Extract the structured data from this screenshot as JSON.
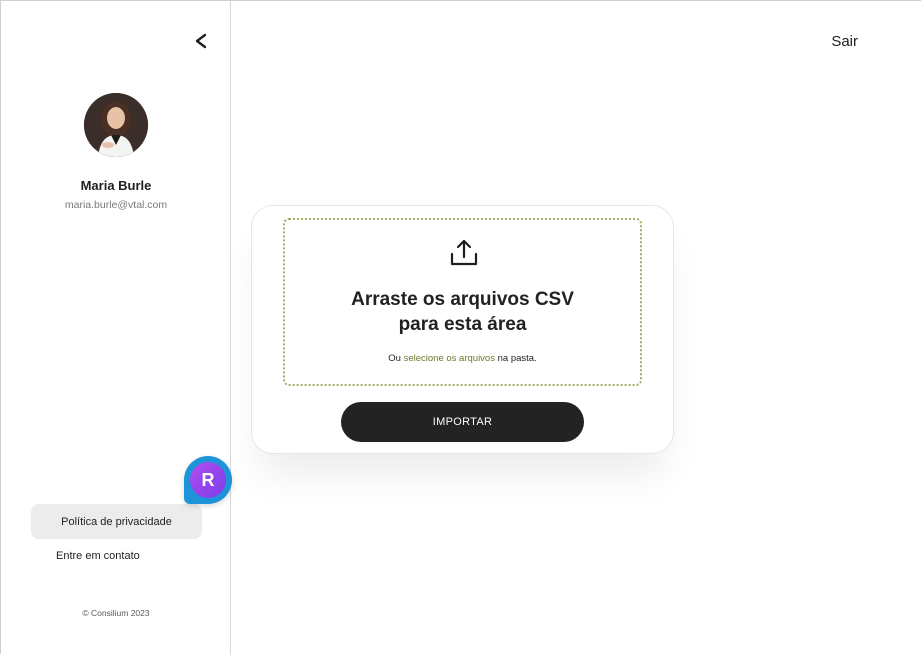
{
  "header": {
    "logout_label": "Sair",
    "collapse_icon": "chevron-left-icon"
  },
  "sidebar": {
    "user": {
      "name": "Maria Burle",
      "email": "maria.burle@vtal.com"
    },
    "nav": {
      "privacy_label": "Política de privacidade",
      "contact_label": "Entre em contato"
    },
    "copyright": "© Consilium 2023"
  },
  "upload": {
    "icon": "upload-icon",
    "title_line1": "Arraste os arquivos CSV",
    "title_line2": "para esta área",
    "hint_prefix": "Ou ",
    "hint_link": "selecione os arquivos",
    "hint_suffix": " na pasta.",
    "import_label": "IMPORTAR"
  },
  "floating_badge": {
    "letter": "R"
  },
  "colors": {
    "accent_link": "#6b7a2a",
    "dropzone_border": "#a4ad66",
    "button_bg": "#232323",
    "badge_outer": "#1d93d8",
    "badge_inner": "#8e44ec"
  }
}
